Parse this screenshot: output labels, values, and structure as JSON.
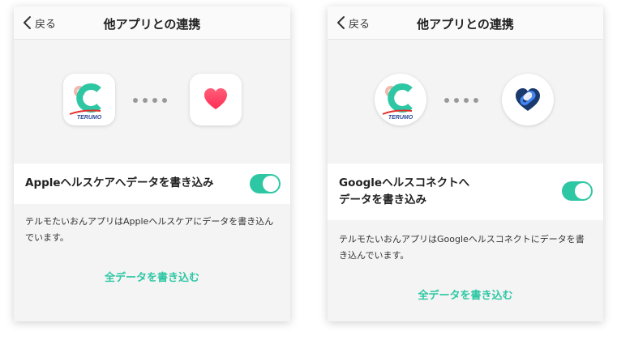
{
  "colors": {
    "accent": "#2ec7a4",
    "terumo_red": "#e0302a",
    "heart_red": "#ff2d55",
    "health_connect_blue": "#4285f4"
  },
  "left": {
    "back_label": "戻る",
    "title": "他アプリとの連携",
    "source_app": {
      "icon": "terumo-app-icon",
      "logo_text": "TERUMO"
    },
    "target_app": {
      "icon": "apple-health-icon"
    },
    "toggle": {
      "label": "Appleヘルスケアへデータを書き込み",
      "state": "on"
    },
    "description": "テルモたいおんアプリはAppleヘルスケアにデータを書き込んでいます。",
    "action_label": "全データを書き込む"
  },
  "right": {
    "back_label": "戻る",
    "title": "他アプリとの連携",
    "source_app": {
      "icon": "terumo-app-icon",
      "logo_text": "TERUMO"
    },
    "target_app": {
      "icon": "health-connect-icon"
    },
    "toggle": {
      "label_line1": "Googleヘルスコネクトへ",
      "label_line2": "データを書き込み",
      "state": "on"
    },
    "description": "テルモたいおんアプリはGoogleヘルスコネクトにデータを書き込んでいます。",
    "action_label": "全データを書き込む"
  }
}
